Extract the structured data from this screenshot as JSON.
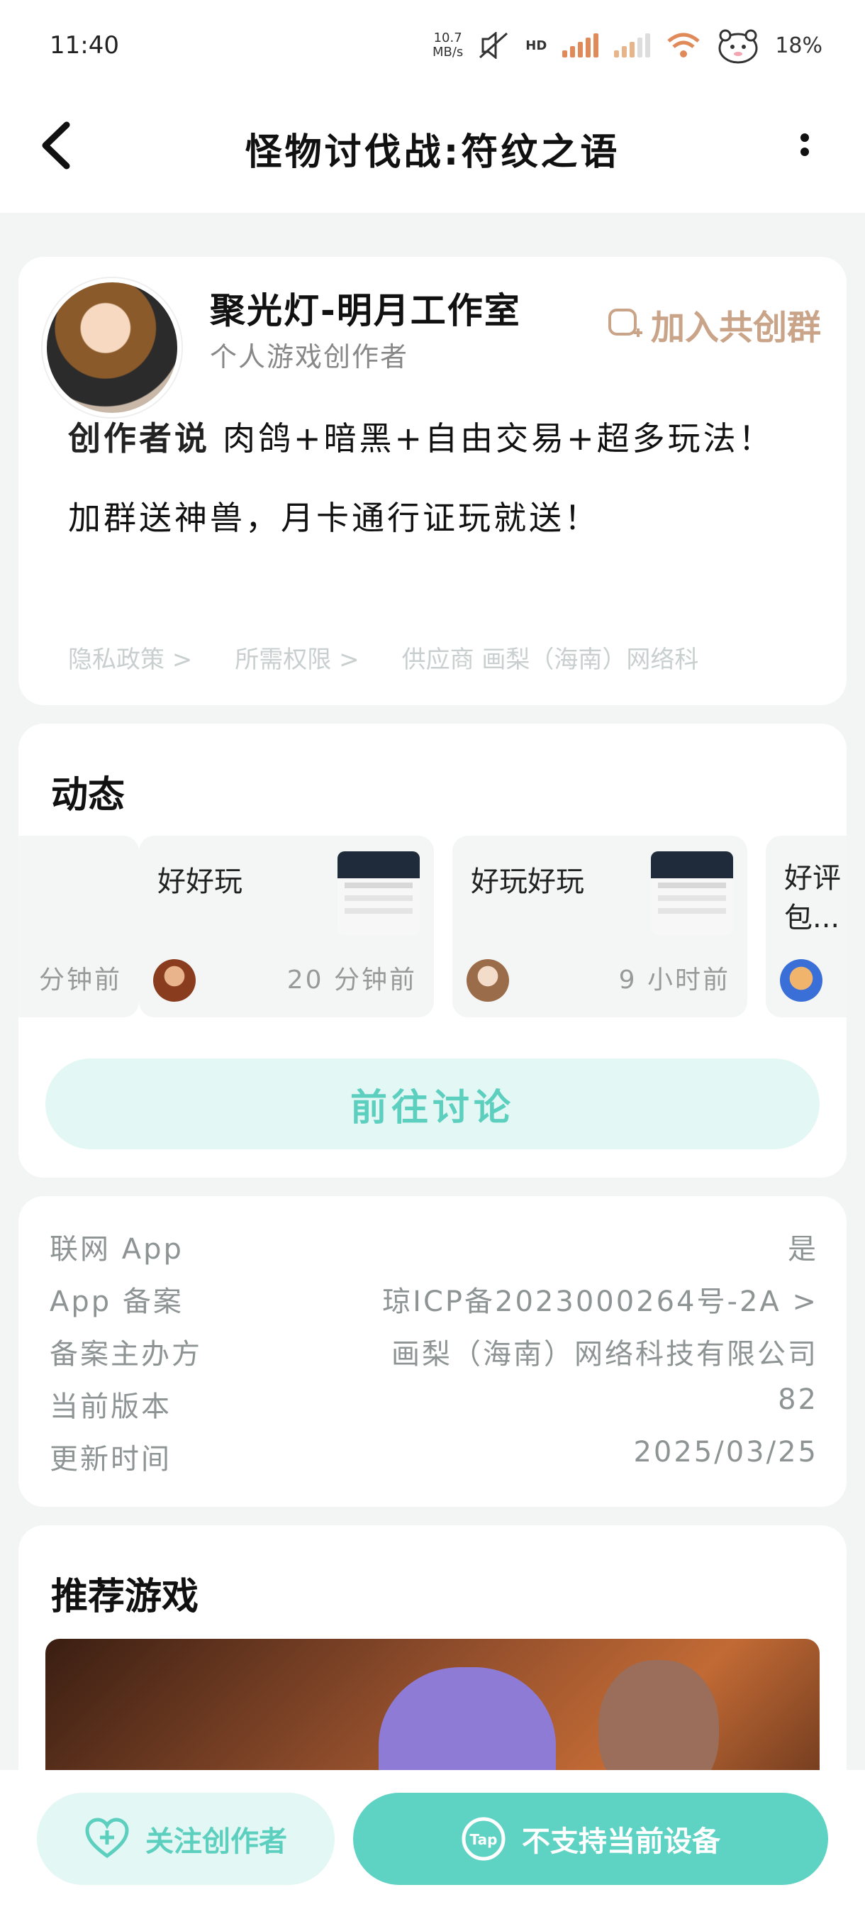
{
  "status_bar": {
    "time": "11:40",
    "net_speed_value": "10.7",
    "net_speed_unit": "MB/s",
    "hd_label": "HD",
    "battery": "18%"
  },
  "header": {
    "title": "怪物讨伐战:符纹之语",
    "back_icon": "chevron-left-icon",
    "more_icon": "vertical-dots-icon"
  },
  "creator": {
    "name": "聚光灯-明月工作室",
    "role": "个人游戏创作者",
    "join_label": "加入共创群",
    "desc_label": "创作者说",
    "desc_text": "肉鸽+暗黑+自由交易+超多玩法！加群送神兽，月卡通行证玩就送！",
    "links": [
      "隐私政策 >",
      "所需权限 >",
      "供应商 画梨（海南）网络科"
    ]
  },
  "dynamics": {
    "title": "动态",
    "posts": [
      {
        "title": "",
        "time": "分钟前"
      },
      {
        "title": "好好玩",
        "time": "20 分钟前"
      },
      {
        "title": "好玩好玩",
        "time": "9 小时前"
      },
      {
        "title": "好评包...",
        "time": ""
      }
    ],
    "discuss_label": "前往讨论"
  },
  "info": {
    "rows": [
      {
        "key": "联网 App",
        "value": "是"
      },
      {
        "key": "App 备案",
        "value": "琼ICP备2023000264号-2A >"
      },
      {
        "key": "备案主办方",
        "value": "画梨（海南）网络科技有限公司"
      },
      {
        "key": "当前版本",
        "value": "82"
      },
      {
        "key": "更新时间",
        "value": "2025/03/25"
      }
    ]
  },
  "recommend": {
    "title": "推荐游戏"
  },
  "bottom": {
    "follow_label": "关注创作者",
    "not_supported_label": "不支持当前设备",
    "tap_logo": "Tap"
  },
  "colors": {
    "accent": "#5fd3c3",
    "accent_light": "#e3f7f4",
    "join_color": "#c9a488"
  }
}
